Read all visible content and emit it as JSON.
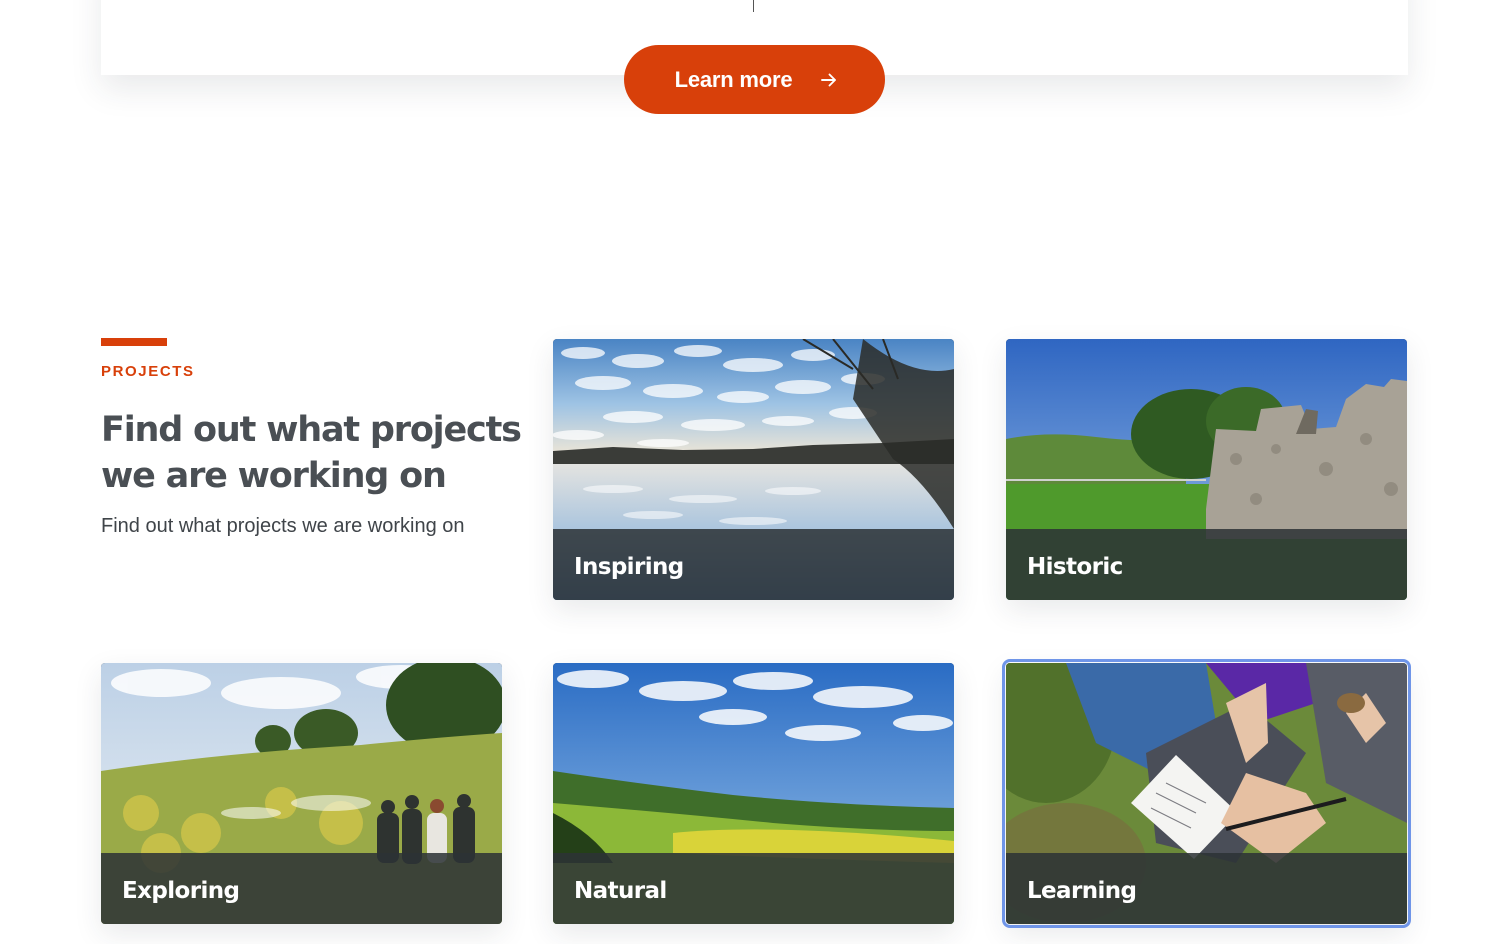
{
  "top_card": {
    "button_label": "Learn more",
    "button_icon": "arrow-right-icon"
  },
  "projects": {
    "eyebrow": "PROJECTS",
    "heading": "Find out what projects we are working on",
    "description": "Find out what projects we are working on",
    "cards": [
      {
        "title": "Inspiring",
        "image": "lake-reflection-clouds"
      },
      {
        "title": "Historic",
        "image": "castle-ruins"
      },
      {
        "title": "Exploring",
        "image": "meadow-walkers"
      },
      {
        "title": "Natural",
        "image": "green-valley-sky"
      },
      {
        "title": "Learning",
        "image": "notebook-hands",
        "selected": true
      }
    ]
  },
  "colors": {
    "accent": "#d8400a",
    "heading": "#4a4f54",
    "card_bar": "#2c3236",
    "focus_outline": "#6f95e8"
  }
}
